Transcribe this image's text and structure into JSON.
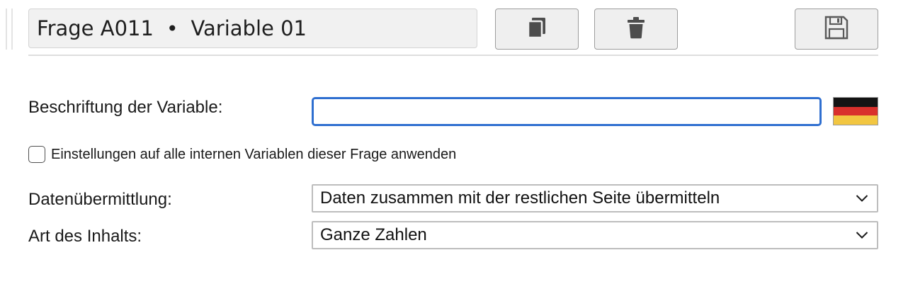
{
  "header": {
    "question": "Frage A011",
    "separator": "•",
    "variable": "Variable 01",
    "buttons": [
      {
        "name": "copy-button",
        "icon": "copy-icon"
      },
      {
        "name": "delete-button",
        "icon": "trash-icon"
      },
      {
        "name": "save-button",
        "icon": "floppy-disk-icon"
      }
    ]
  },
  "form": {
    "caption_label": "Beschriftung der Variable:",
    "caption_value": "",
    "language_flag": "german-flag-icon",
    "apply_all_label": "Einstellungen auf alle internen Variablen dieser Frage anwenden",
    "apply_all_checked": false,
    "transfer_label": "Datenübermittlung:",
    "transfer_value": "Daten zusammen mit der restlichen Seite übermitteln",
    "content_label": "Art des Inhalts:",
    "content_value": "Ganze Zahlen"
  },
  "colors": {
    "focus_border": "#2f6fd0",
    "icon_gray": "#4d4d4d",
    "flag_black": "#141414",
    "flag_red": "#d9302c",
    "flag_gold": "#f2c641"
  }
}
